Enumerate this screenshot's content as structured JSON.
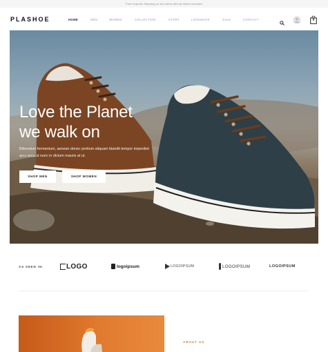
{
  "announcement": "Free Express Shipping on all orders with all duties included",
  "brand": "PLASHOE",
  "nav": [
    {
      "label": "HOME",
      "active": true
    },
    {
      "label": "MEN",
      "active": false
    },
    {
      "label": "WOMEN",
      "active": false
    },
    {
      "label": "COLLECTION",
      "active": false
    },
    {
      "label": "STORY",
      "active": false
    },
    {
      "label": "LOOKBOOK",
      "active": false
    },
    {
      "label": "SALE",
      "active": false
    },
    {
      "label": "CONTACT",
      "active": false
    }
  ],
  "header_icons": {
    "search": "search-icon",
    "account": "user-icon",
    "cart": "bag-icon",
    "cart_count": "0"
  },
  "hero": {
    "title_line1": "Love the Planet",
    "title_line2": "we walk on",
    "subtitle": "Bibendum fermentum, aenean donec pretium aliquam blandit tempor imperdiet arcu arcu ut nunc in dictum mauris at ut.",
    "button_men": "SHOP MEN",
    "button_women": "SHOP WOMEN"
  },
  "as_seen_in": {
    "label": "AS SEEN IN:",
    "logos": [
      "LOGO",
      "logoipsum",
      "LOGOIPSUM",
      "LOGOIPSUM",
      "LOGOIPSUM"
    ]
  },
  "about": {
    "label": "ABOUT US"
  },
  "colors": {
    "accent": "#d08a3a",
    "text_dark": "#222222",
    "muted": "#9a9a9a"
  }
}
